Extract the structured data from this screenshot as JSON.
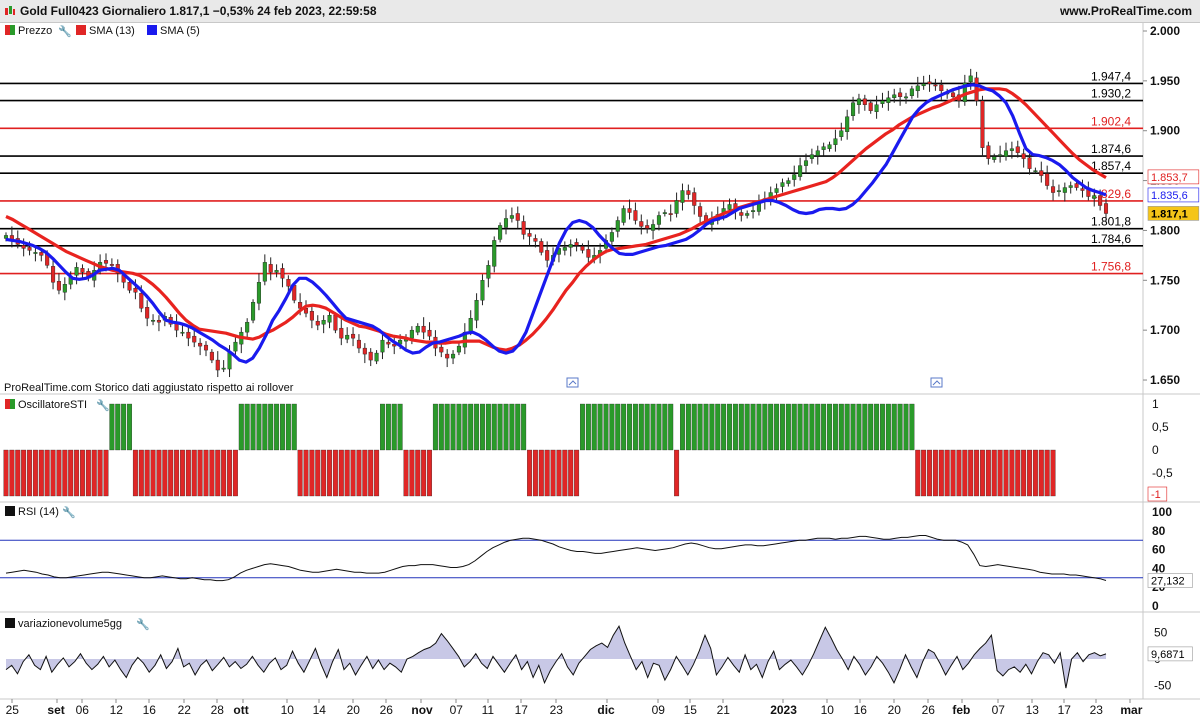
{
  "header": {
    "title": "Gold Full0423 Giornaliero 1.817,1 −0,53% 24 feb 2023, 22:59:58",
    "site": "www.ProRealTime.com"
  },
  "colors": {
    "price_line": "#e8231f",
    "sma5": "#1a1aee",
    "bull": "#2a9a2a",
    "bear": "#e02626",
    "hline_black": "#000000",
    "hline_red": "#e02020",
    "rsi_band": "#2233bb",
    "volume_fill": "#c8c8e6"
  },
  "legend": {
    "price": "Prezzo",
    "sma13": "SMA (13)",
    "sma5": "SMA (5)"
  },
  "note": "ProRealTime.com  Storico dati aggiustato rispetto ai rollover",
  "panels": {
    "sti": "OscillatoreSTI",
    "rsi": "RSI (14)",
    "vol": "variazionevolume5gg"
  },
  "tags": {
    "last_price": "1.817,1",
    "sma13": "1.853,7",
    "sma5": "1.835,6",
    "rsi_last": "27,132",
    "vol_last": "9,6871",
    "sti_last": "-1"
  },
  "chart_data": [
    {
      "type": "candlestick",
      "title": "Gold Full0423 Giornaliero",
      "ylim": [
        1640,
        2005
      ],
      "y_ticks": [
        "1.650",
        "1.700",
        "1.750",
        "1.800",
        "1.850",
        "1.900",
        "1.950",
        "2.000"
      ],
      "y_tick_values": [
        1650,
        1700,
        1750,
        1800,
        1850,
        1900,
        1950,
        2000
      ],
      "x_ticks": [
        "25",
        "set",
        "06",
        "12",
        "16",
        "22",
        "28",
        "ott",
        "10",
        "14",
        "20",
        "26",
        "nov",
        "07",
        "11",
        "17",
        "23",
        "dic",
        "09",
        "15",
        "21",
        "2023",
        "10",
        "16",
        "20",
        "26",
        "feb",
        "07",
        "13",
        "17",
        "23",
        "mar"
      ],
      "x_tick_bold": [
        "set",
        "ott",
        "nov",
        "dic",
        "2023",
        "feb",
        "mar"
      ],
      "levels": [
        {
          "label": "1.947,4",
          "value": 1947.4,
          "color": "black"
        },
        {
          "label": "1.930,2",
          "value": 1930.2,
          "color": "black"
        },
        {
          "label": "1.902,4",
          "value": 1902.4,
          "color": "red"
        },
        {
          "label": "1.874,6",
          "value": 1874.6,
          "color": "black"
        },
        {
          "label": "1.857,4",
          "value": 1857.4,
          "color": "black"
        },
        {
          "label": "1.829,6",
          "value": 1829.6,
          "color": "red"
        },
        {
          "label": "1.801,8",
          "value": 1801.8,
          "color": "black"
        },
        {
          "label": "1.784,6",
          "value": 1784.6,
          "color": "black"
        },
        {
          "label": "1.756,8",
          "value": 1756.8,
          "color": "red"
        }
      ],
      "close": [
        1795,
        1790,
        1786,
        1782,
        1780,
        1778,
        1775,
        1765,
        1748,
        1740,
        1746,
        1753,
        1763,
        1758,
        1752,
        1760,
        1768,
        1767,
        1765,
        1757,
        1748,
        1740,
        1738,
        1722,
        1712,
        1710,
        1708,
        1714,
        1706,
        1700,
        1698,
        1692,
        1688,
        1684,
        1680,
        1670,
        1660,
        1662,
        1678,
        1688,
        1698,
        1708,
        1728,
        1748,
        1768,
        1758,
        1760,
        1752,
        1744,
        1730,
        1722,
        1717,
        1710,
        1705,
        1710,
        1715,
        1700,
        1692,
        1695,
        1692,
        1682,
        1676,
        1670,
        1677,
        1690,
        1686,
        1684,
        1690,
        1691,
        1700,
        1704,
        1698,
        1694,
        1682,
        1678,
        1672,
        1676,
        1684,
        1698,
        1712,
        1730,
        1750,
        1765,
        1790,
        1805,
        1812,
        1815,
        1810,
        1796,
        1794,
        1789,
        1778,
        1770,
        1775,
        1782,
        1783,
        1786,
        1785,
        1780,
        1773,
        1775,
        1780,
        1790,
        1798,
        1810,
        1822,
        1818,
        1810,
        1804,
        1802,
        1806,
        1815,
        1818,
        1816,
        1830,
        1840,
        1836,
        1825,
        1814,
        1808,
        1810,
        1816,
        1822,
        1826,
        1820,
        1815,
        1817,
        1820,
        1828,
        1832,
        1838,
        1842,
        1848,
        1850,
        1856,
        1865,
        1870,
        1876,
        1880,
        1884,
        1886,
        1892,
        1900,
        1914,
        1928,
        1932,
        1926,
        1920,
        1926,
        1930,
        1933,
        1936,
        1934,
        1934,
        1942,
        1945,
        1947,
        1947,
        1945,
        1940,
        1938,
        1934,
        1930,
        1948,
        1955,
        1930,
        1883,
        1872,
        1874,
        1876,
        1880,
        1882,
        1878,
        1872,
        1862,
        1860,
        1855,
        1845,
        1838,
        1840,
        1843,
        1845,
        1843,
        1840,
        1834,
        1835,
        1825,
        1817
      ],
      "sma13": [
        1814,
        1811,
        1807,
        1803,
        1799,
        1795,
        1791,
        1787,
        1783,
        1779,
        1776,
        1773,
        1770,
        1767,
        1764,
        1762,
        1760,
        1759,
        1758,
        1757,
        1755,
        1751,
        1746,
        1740,
        1733,
        1725,
        1717,
        1710,
        1705,
        1701,
        1700,
        1699,
        1698,
        1697,
        1695,
        1693,
        1692,
        1691,
        1693,
        1697,
        1700,
        1704,
        1708,
        1713,
        1719,
        1724,
        1725,
        1724,
        1722,
        1718,
        1714,
        1710,
        1707,
        1704,
        1703,
        1701,
        1699,
        1696,
        1694,
        1693,
        1692,
        1690,
        1689,
        1688,
        1688,
        1687,
        1687,
        1688,
        1688,
        1689,
        1689,
        1689,
        1686,
        1683,
        1681,
        1680,
        1682,
        1685,
        1690,
        1696,
        1703,
        1711,
        1720,
        1730,
        1740,
        1748,
        1757,
        1764,
        1770,
        1775,
        1779,
        1781,
        1782,
        1783,
        1784,
        1785,
        1786,
        1788,
        1790,
        1792,
        1794,
        1796,
        1799,
        1802,
        1806,
        1809,
        1812,
        1815,
        1818,
        1820,
        1823,
        1825,
        1827,
        1829,
        1831,
        1833,
        1835,
        1837,
        1839,
        1841,
        1843,
        1845,
        1847,
        1849,
        1853,
        1858,
        1864,
        1870,
        1876,
        1882,
        1887,
        1892,
        1897,
        1901,
        1906,
        1910,
        1914,
        1917,
        1920,
        1923,
        1925,
        1928,
        1931,
        1934,
        1937,
        1939,
        1941,
        1942,
        1942,
        1942,
        1941,
        1937,
        1932,
        1926,
        1919,
        1912,
        1905,
        1898,
        1891,
        1884,
        1877,
        1871,
        1866,
        1861,
        1857,
        1853
      ],
      "sma5": [
        1791,
        1790,
        1789,
        1787,
        1785,
        1782,
        1778,
        1772,
        1765,
        1758,
        1752,
        1751,
        1752,
        1755,
        1760,
        1761,
        1762,
        1760,
        1754,
        1748,
        1742,
        1735,
        1727,
        1718,
        1710,
        1708,
        1707,
        1705,
        1702,
        1698,
        1694,
        1690,
        1685,
        1681,
        1676,
        1670,
        1668,
        1672,
        1682,
        1695,
        1710,
        1720,
        1732,
        1745,
        1752,
        1752,
        1748,
        1742,
        1735,
        1727,
        1719,
        1712,
        1710,
        1708,
        1706,
        1704,
        1700,
        1694,
        1689,
        1685,
        1680,
        1677,
        1678,
        1683,
        1687,
        1688,
        1690,
        1692,
        1694,
        1697,
        1698,
        1695,
        1690,
        1684,
        1679,
        1677,
        1679,
        1686,
        1698,
        1716,
        1734,
        1752,
        1770,
        1787,
        1800,
        1808,
        1810,
        1808,
        1803,
        1795,
        1788,
        1782,
        1777,
        1776,
        1776,
        1778,
        1780,
        1782,
        1784,
        1785,
        1787,
        1789,
        1791,
        1795,
        1800,
        1806,
        1810,
        1812,
        1814,
        1818,
        1822,
        1824,
        1826,
        1828,
        1830,
        1830,
        1828,
        1825,
        1821,
        1818,
        1817,
        1818,
        1821,
        1822,
        1822,
        1821,
        1822,
        1826,
        1832,
        1840,
        1848,
        1857,
        1866,
        1878,
        1890,
        1902,
        1914,
        1922,
        1928,
        1932,
        1935,
        1938,
        1941,
        1943,
        1945,
        1946,
        1945,
        1942,
        1940,
        1935,
        1928,
        1915,
        1898,
        1882,
        1876,
        1875,
        1873,
        1870,
        1866,
        1860,
        1853,
        1848,
        1843,
        1840,
        1838,
        1835.6
      ]
    },
    {
      "type": "bar",
      "title": "OscillatoreSTI",
      "ylim": [
        -1,
        1
      ],
      "y_ticks": [
        "1",
        "0,5",
        "0",
        "-0,5",
        "-1"
      ],
      "segments": [
        {
          "value": -1,
          "count": 18
        },
        {
          "value": 1,
          "count": 4
        },
        {
          "value": -1,
          "count": 18
        },
        {
          "value": 1,
          "count": 10
        },
        {
          "value": -1,
          "count": 14
        },
        {
          "value": 1,
          "count": 4
        },
        {
          "value": -1,
          "count": 5
        },
        {
          "value": 1,
          "count": 16
        },
        {
          "value": -1,
          "count": 9
        },
        {
          "value": 1,
          "count": 16
        },
        {
          "value": -1,
          "count": 1
        },
        {
          "value": 1,
          "count": 40
        },
        {
          "value": -1,
          "count": 24
        }
      ]
    },
    {
      "type": "line",
      "title": "RSI (14)",
      "ylim": [
        0,
        100
      ],
      "y_ticks": [
        "100",
        "80",
        "60",
        "40",
        "20",
        "0"
      ],
      "bands": [
        30,
        70
      ],
      "values": [
        35,
        36,
        37,
        38,
        37,
        36,
        34,
        33,
        31,
        30,
        30,
        31,
        32,
        33,
        34,
        35,
        36,
        36,
        35,
        34,
        33,
        32,
        31,
        30,
        30,
        31,
        32,
        31,
        30,
        29,
        29,
        30,
        29,
        28,
        28,
        27,
        27,
        28,
        31,
        35,
        38,
        40,
        42,
        44,
        45,
        44,
        43,
        42,
        40,
        38,
        37,
        36,
        36,
        37,
        38,
        39,
        38,
        37,
        36,
        36,
        35,
        35,
        35,
        36,
        38,
        40,
        42,
        43,
        43,
        44,
        44,
        44,
        43,
        42,
        41,
        41,
        42,
        44,
        48,
        53,
        58,
        62,
        65,
        68,
        70,
        71,
        72,
        72,
        71,
        70,
        68,
        66,
        63,
        61,
        59,
        58,
        58,
        57,
        56,
        56,
        57,
        58,
        59,
        60,
        61,
        62,
        61,
        60,
        59,
        60,
        61,
        62,
        64,
        66,
        67,
        66,
        64,
        62,
        61,
        61,
        62,
        63,
        64,
        65,
        65,
        64,
        64,
        65,
        66,
        67,
        68,
        69,
        70,
        70,
        71,
        72,
        72,
        72,
        71,
        72,
        72,
        73,
        74,
        74,
        73,
        72,
        71,
        71,
        72,
        73,
        73,
        74,
        75,
        75,
        73,
        71,
        70,
        70,
        70,
        68,
        65,
        55,
        43,
        42,
        43,
        44,
        43,
        42,
        41,
        40,
        39,
        38,
        36,
        35,
        34,
        34,
        34,
        33,
        33,
        32,
        31,
        30,
        29,
        27.132
      ]
    },
    {
      "type": "area",
      "title": "variazionevolume5gg",
      "ylim": [
        -70,
        70
      ],
      "y_ticks": [
        "50",
        "0",
        "-50"
      ],
      "values": [
        -20,
        -12,
        -28,
        -5,
        8,
        -12,
        -20,
        5,
        -25,
        -10,
        2,
        -15,
        -5,
        10,
        -8,
        -20,
        -10,
        5,
        -15,
        -2,
        -20,
        -35,
        -12,
        3,
        -8,
        -25,
        -12,
        8,
        -18,
        -5,
        20,
        -15,
        -8,
        -30,
        -12,
        -2,
        -22,
        -10,
        3,
        -15,
        -5,
        -18,
        -10,
        5,
        -12,
        -25,
        -8,
        2,
        -20,
        -12,
        15,
        -8,
        -25,
        -3,
        20,
        -10,
        -35,
        -5,
        18,
        -20,
        -8,
        -30,
        -12,
        5,
        -18,
        -2,
        -20,
        -8,
        -15,
        -25,
        0,
        5,
        12,
        18,
        22,
        30,
        48,
        35,
        20,
        5,
        -15,
        -5,
        10,
        -8,
        -18,
        5,
        -10,
        -25,
        -8,
        8,
        -20,
        -5,
        -35,
        -12,
        -45,
        -22,
        -5,
        10,
        -15,
        -30,
        -8,
        5,
        18,
        25,
        30,
        22,
        45,
        62,
        30,
        5,
        -20,
        -5,
        -35,
        -8,
        -12,
        -40,
        -20,
        5,
        -12,
        -30,
        -10,
        15,
        45,
        20,
        -30,
        -15,
        3,
        -12,
        -25,
        8,
        -20,
        -10,
        -35,
        -5,
        15,
        -20,
        -10,
        -2,
        -15,
        -30,
        -12,
        10,
        35,
        60,
        40,
        18,
        0,
        -20,
        5,
        -10,
        -30,
        -15,
        5,
        -8,
        -25,
        -45,
        -20,
        8,
        -15,
        -35,
        -5,
        18,
        12,
        -8,
        -30,
        -12,
        5,
        -20,
        -8,
        8,
        20,
        30,
        45,
        -22,
        -32,
        -20,
        -15,
        -25,
        -10,
        -28,
        -5,
        12,
        8,
        -8,
        12,
        -55,
        0,
        12,
        -5,
        8,
        12,
        6,
        9.6871
      ]
    }
  ]
}
